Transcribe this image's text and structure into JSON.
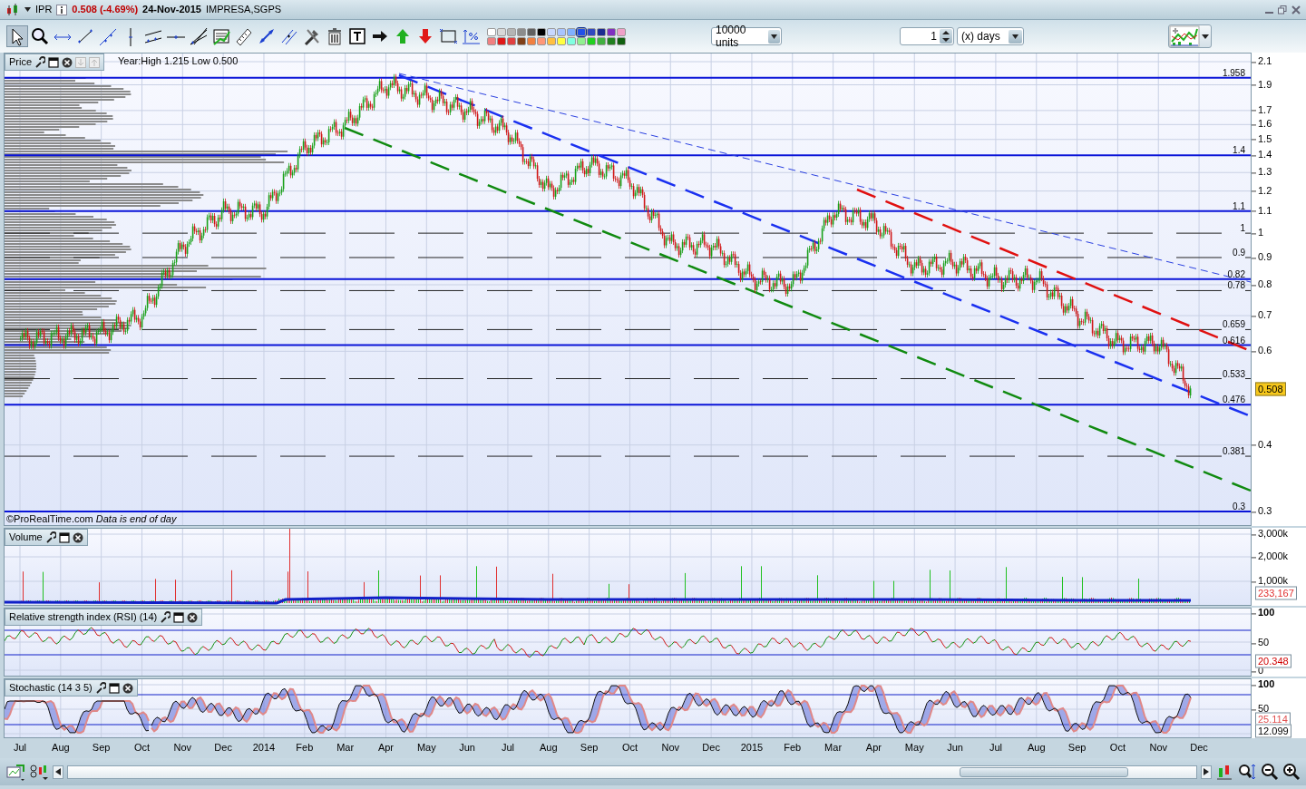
{
  "window": {
    "symbol": "IPR",
    "price_change": "0.508 (-4.69%)",
    "date": "24-Nov-2015",
    "name": "IMPRESA,SGPS"
  },
  "toolbar": {
    "palette": [
      {
        "color": "#ffffff",
        "selected": false
      },
      {
        "color": "#d8d8d8",
        "selected": false
      },
      {
        "color": "#b4b4b4",
        "selected": false
      },
      {
        "color": "#8c8c8c",
        "selected": false
      },
      {
        "color": "#606060",
        "selected": false
      },
      {
        "color": "#000000",
        "selected": false
      },
      {
        "color": "#c8d8ff",
        "selected": false
      },
      {
        "color": "#a8c4ff",
        "selected": false
      },
      {
        "color": "#80b0ff",
        "selected": false
      },
      {
        "color": "#2050e8",
        "selected": true
      },
      {
        "color": "#3048c0",
        "selected": false
      },
      {
        "color": "#1c2c90",
        "selected": false
      },
      {
        "color": "#8030c0",
        "selected": false
      },
      {
        "color": "#f0a0c8",
        "selected": false
      },
      {
        "color": "#f08080",
        "selected": false
      },
      {
        "color": "#e01818",
        "selected": false
      },
      {
        "color": "#e04040",
        "selected": false
      },
      {
        "color": "#804018",
        "selected": false
      },
      {
        "color": "#f08040",
        "selected": false
      },
      {
        "color": "#ff9878",
        "selected": false
      },
      {
        "color": "#ffc040",
        "selected": false
      },
      {
        "color": "#ffff40",
        "selected": false
      },
      {
        "color": "#80ffe0",
        "selected": false
      },
      {
        "color": "#90f090",
        "selected": false
      },
      {
        "color": "#20d020",
        "selected": false
      },
      {
        "color": "#40b040",
        "selected": false
      },
      {
        "color": "#208020",
        "selected": false
      },
      {
        "color": "#106010",
        "selected": false
      }
    ],
    "quantity": "10000 units",
    "period_count": "1",
    "period_unit": "(x) days"
  },
  "price_panel": {
    "title": "Price",
    "y_axis_labels": [
      "2.1",
      "1.9",
      "1.7",
      "1.6",
      "1.5",
      "1.4",
      "1.3",
      "1.2",
      "1.1",
      "1",
      "0.9",
      "0.8",
      "0.7",
      "0.6",
      "0.4",
      "0.3"
    ],
    "year_range": "Year:High 1.215 Low 0.500",
    "footer": "©ProRealTime.com *Data is end of day*",
    "level_labels": [
      "1.958",
      "1.4",
      "1.1",
      "1",
      "0.9",
      "0.82",
      "0.78",
      "0.659",
      "0.616",
      "0.533",
      "0.476",
      "0.381",
      "0.3"
    ],
    "last_price": "0.508"
  },
  "x_axis_labels": [
    "Jul",
    "Aug",
    "Sep",
    "Oct",
    "Nov",
    "Dec",
    "2014",
    "Feb",
    "Mar",
    "Apr",
    "May",
    "Jun",
    "Jul",
    "Aug",
    "Sep",
    "Oct",
    "Nov",
    "Dec",
    "2015",
    "Feb",
    "Mar",
    "Apr",
    "May",
    "Jun",
    "Jul",
    "Aug",
    "Sep",
    "Oct",
    "Nov",
    "Dec"
  ],
  "volume_panel": {
    "title": "Volume",
    "ticks": [
      "3,000k",
      "2,000k",
      "1,000k"
    ],
    "value": "233,167"
  },
  "rsi_panel": {
    "title": "Relative strength index (RSI) (14)",
    "ticks": [
      "100",
      "50",
      "0"
    ],
    "value": "20.348"
  },
  "stochastic_panel": {
    "title": "Stochastic (14 3 5)",
    "ticks": [
      "100",
      "50"
    ],
    "values": [
      "25.114",
      "12.099"
    ]
  }
}
